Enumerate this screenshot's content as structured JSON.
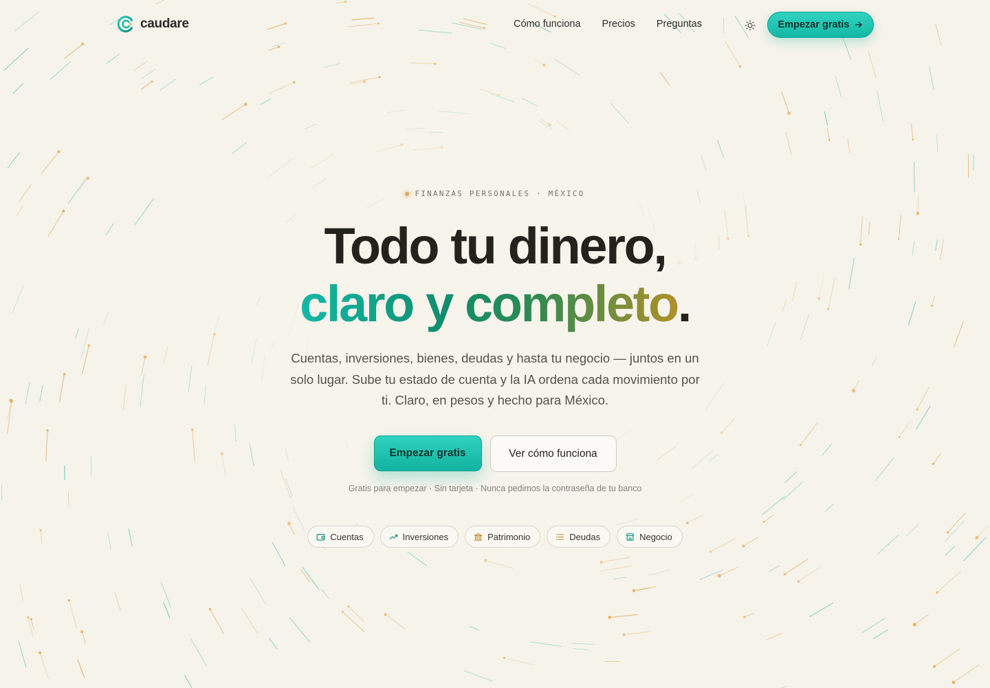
{
  "brand": {
    "name": "caudare",
    "accent": "#14b8a6",
    "gold": "#e0a85a",
    "background": "#f6f3ea"
  },
  "nav": {
    "links": [
      "Cómo funciona",
      "Precios",
      "Preguntas"
    ],
    "theme_icon": "sun-icon",
    "cta_label": "Empezar gratis",
    "cta_icon": "arrow-right-icon"
  },
  "hero": {
    "eyebrow": "FINANZAS PERSONALES · MÉXICO",
    "headline_line1": "Todo tu dinero,",
    "headline_line2": "claro y completo",
    "headline_period": ".",
    "subtitle": "Cuentas, inversiones, bienes, deudas y hasta tu negocio — juntos en un solo lugar. Sube tu estado de cuenta y la IA ordena cada movimiento por ti. Claro, en pesos y hecho para México.",
    "primary_cta": "Empezar gratis",
    "secondary_cta": "Ver cómo funciona",
    "fineprint": "Gratis para empezar · Sin tarjeta · Nunca pedimos la contraseña de tu banco"
  },
  "chips": [
    {
      "label": "Cuentas",
      "icon": "wallet-icon"
    },
    {
      "label": "Inversiones",
      "icon": "trend-up-icon"
    },
    {
      "label": "Patrimonio",
      "icon": "bank-icon"
    },
    {
      "label": "Deudas",
      "icon": "list-icon"
    },
    {
      "label": "Negocio",
      "icon": "store-icon"
    }
  ]
}
